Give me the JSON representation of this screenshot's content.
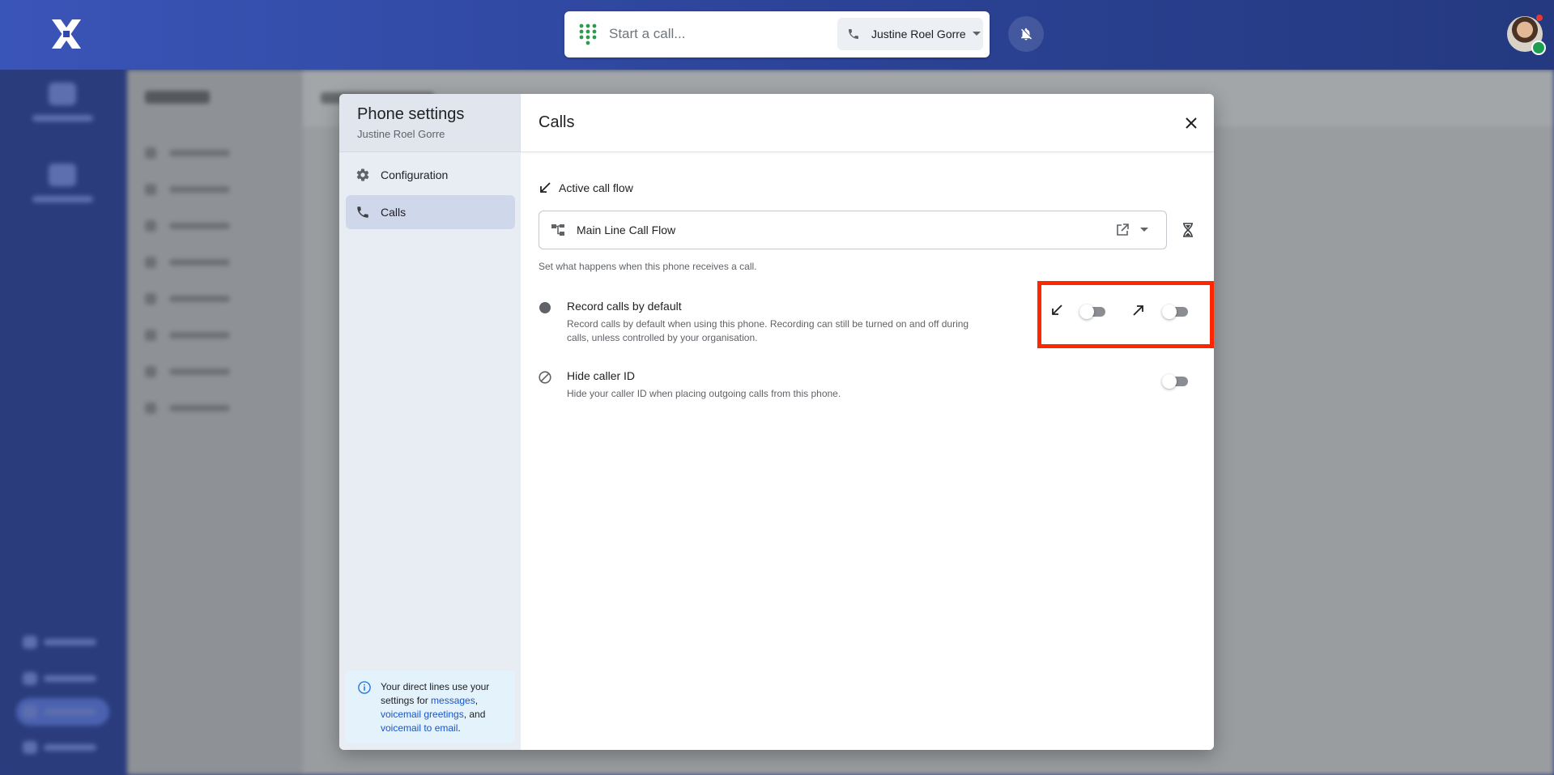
{
  "topbar": {
    "call_placeholder": "Start a call...",
    "phone_name": "Justine Roel Gorre"
  },
  "modal": {
    "sidebar": {
      "title": "Phone settings",
      "subtitle": "Justine Roel Gorre",
      "items": [
        {
          "label": "Configuration",
          "icon": "gear-icon",
          "active": false
        },
        {
          "label": "Calls",
          "icon": "phone-icon",
          "active": true
        }
      ],
      "info": {
        "prefix": "Your direct lines use your settings for ",
        "link_messages": "messages",
        "sep1": ", ",
        "link_greetings": "voicemail greetings",
        "sep2": ", and ",
        "link_email": "voicemail to email",
        "suffix": "."
      }
    },
    "main": {
      "title": "Calls",
      "call_flow": {
        "label": "Active call flow",
        "value": "Main Line Call Flow",
        "hint": "Set what happens when this phone receives a call."
      },
      "record": {
        "title": "Record calls by default",
        "description": "Record calls by default when using this phone. Recording can still be turned on and off during calls, unless controlled by your organisation.",
        "incoming_on": false,
        "outgoing_on": false
      },
      "hide_caller": {
        "title": "Hide caller ID",
        "description": "Hide your caller ID when placing outgoing calls from this phone.",
        "on": false
      }
    }
  },
  "colors": {
    "topbar": "#2c4499",
    "highlight": "#ff2600",
    "link": "#1a55c9",
    "status_online": "#1e9e50"
  }
}
